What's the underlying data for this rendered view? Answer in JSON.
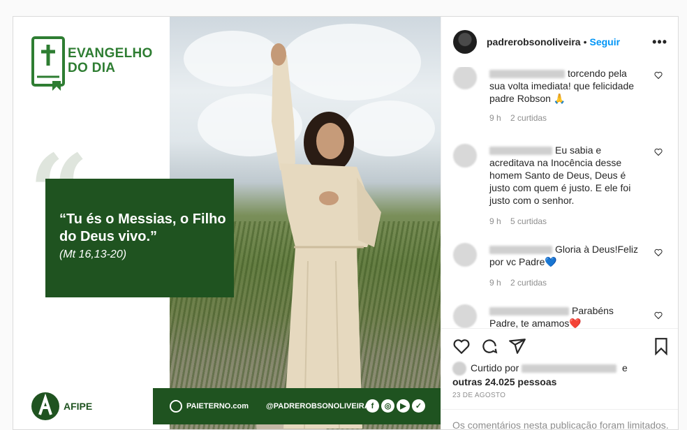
{
  "image": {
    "logo_title": "EVANGELHO\nDO DIA",
    "quote_text": "“Tu és o Messias, o Filho do Deus vivo.”",
    "quote_ref": "(Mt 16,13-20)",
    "footer_site": "PAIETERNO.com",
    "footer_handle": "@PADREROBSONOLIVEIRA",
    "org_name": "AFIPE"
  },
  "header": {
    "username": "padrerobsonoliveira",
    "separator": "•",
    "follow_label": "Seguir",
    "more_label": "•••"
  },
  "comments": [
    {
      "text": "torcendo pela sua volta imediata! que felicidade padre Robson 🙏",
      "time": "9 h",
      "likes": "2 curtidas"
    },
    {
      "text": "Eu sabia e acreditava na Inocência desse homem Santo de Deus, Deus é justo com quem é justo. E ele foi justo com o senhor.",
      "time": "9 h",
      "likes": "5 curtidas"
    },
    {
      "text": "Gloria à Deus!Feliz por vc Padre💙",
      "time": "9 h",
      "likes": "2 curtidas"
    },
    {
      "text": "Parabéns Padre, te amamos❤️",
      "time": "",
      "likes": ""
    }
  ],
  "likes": {
    "prefix": "Curtido por",
    "connector": "e",
    "others": "outras 24.025 pessoas"
  },
  "date": "23 DE AGOSTO",
  "limited_notice": "Os comentários nesta publicação foram limitados.",
  "colors": {
    "brand_green": "#1f5320",
    "link_blue": "#0095f6"
  },
  "icons": [
    "heart-icon",
    "comment-icon",
    "share-icon",
    "bookmark-icon",
    "more-options-icon",
    "cross-bible-icon",
    "globe-icon"
  ]
}
